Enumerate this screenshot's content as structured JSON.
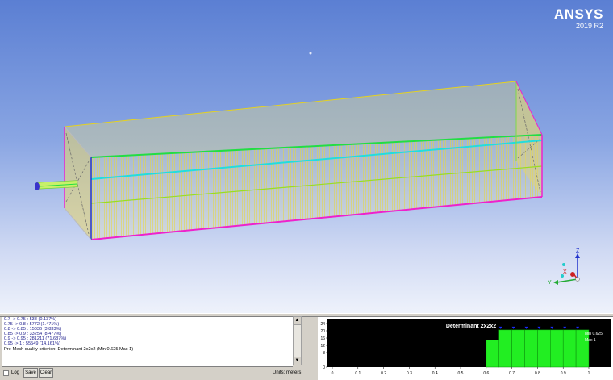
{
  "brand": {
    "name": "ANSYS",
    "version": "2019 R2"
  },
  "triad": {
    "x": "X",
    "y": "Y",
    "z": "Z"
  },
  "console": {
    "lines": [
      "0.7 -> 0.75 : 538 (0.137%)",
      "0.75 -> 0.8 : 5772 (1.471%)",
      "0.8 -> 0.85 : 15036 (3.833%)",
      "0.85 -> 0.9 : 33254 (8.477%)",
      "0.9 -> 0.95 : 281211 (71.687%)",
      "0.95 -> 1 : 55549 (14.161%)",
      "Pre-Mesh quality criterion: Determinant 2x2x2 (Min 0.625 Max 1)"
    ],
    "log_label": "Log",
    "save_label": "Save",
    "clear_label": "Clear",
    "units_label": "Units: meters"
  },
  "colors": {
    "mesh": "#e6d21e",
    "edge_green": "#22dd44",
    "edge_cyan": "#22dddd",
    "edge_magenta": "#ee22cc",
    "edge_blue": "#2233cc",
    "bar": "#22ee22",
    "marker": "#1a2cff"
  },
  "chart_data": {
    "type": "bar",
    "title": "Determinant 2x2x2",
    "annotation": [
      "Min 0.625",
      "Max 1"
    ],
    "xlim": [
      0,
      1
    ],
    "ylim": [
      0,
      24
    ],
    "xticks": [
      "0",
      "0.1",
      "0.2",
      "0.3",
      "0.4",
      "0.5",
      "0.6",
      "0.7",
      "0.8",
      "0.9",
      "1"
    ],
    "yticks": [
      "0",
      "8",
      "12",
      "16",
      "20",
      "24"
    ],
    "bin_edges": [
      0.6,
      0.65,
      0.7,
      0.75,
      0.8,
      0.85,
      0.9,
      0.95,
      1.0
    ],
    "values": [
      15,
      20.5,
      20.5,
      20.5,
      20.5,
      20.5,
      20.5,
      20.5
    ],
    "grid": false,
    "background": "#000000"
  }
}
